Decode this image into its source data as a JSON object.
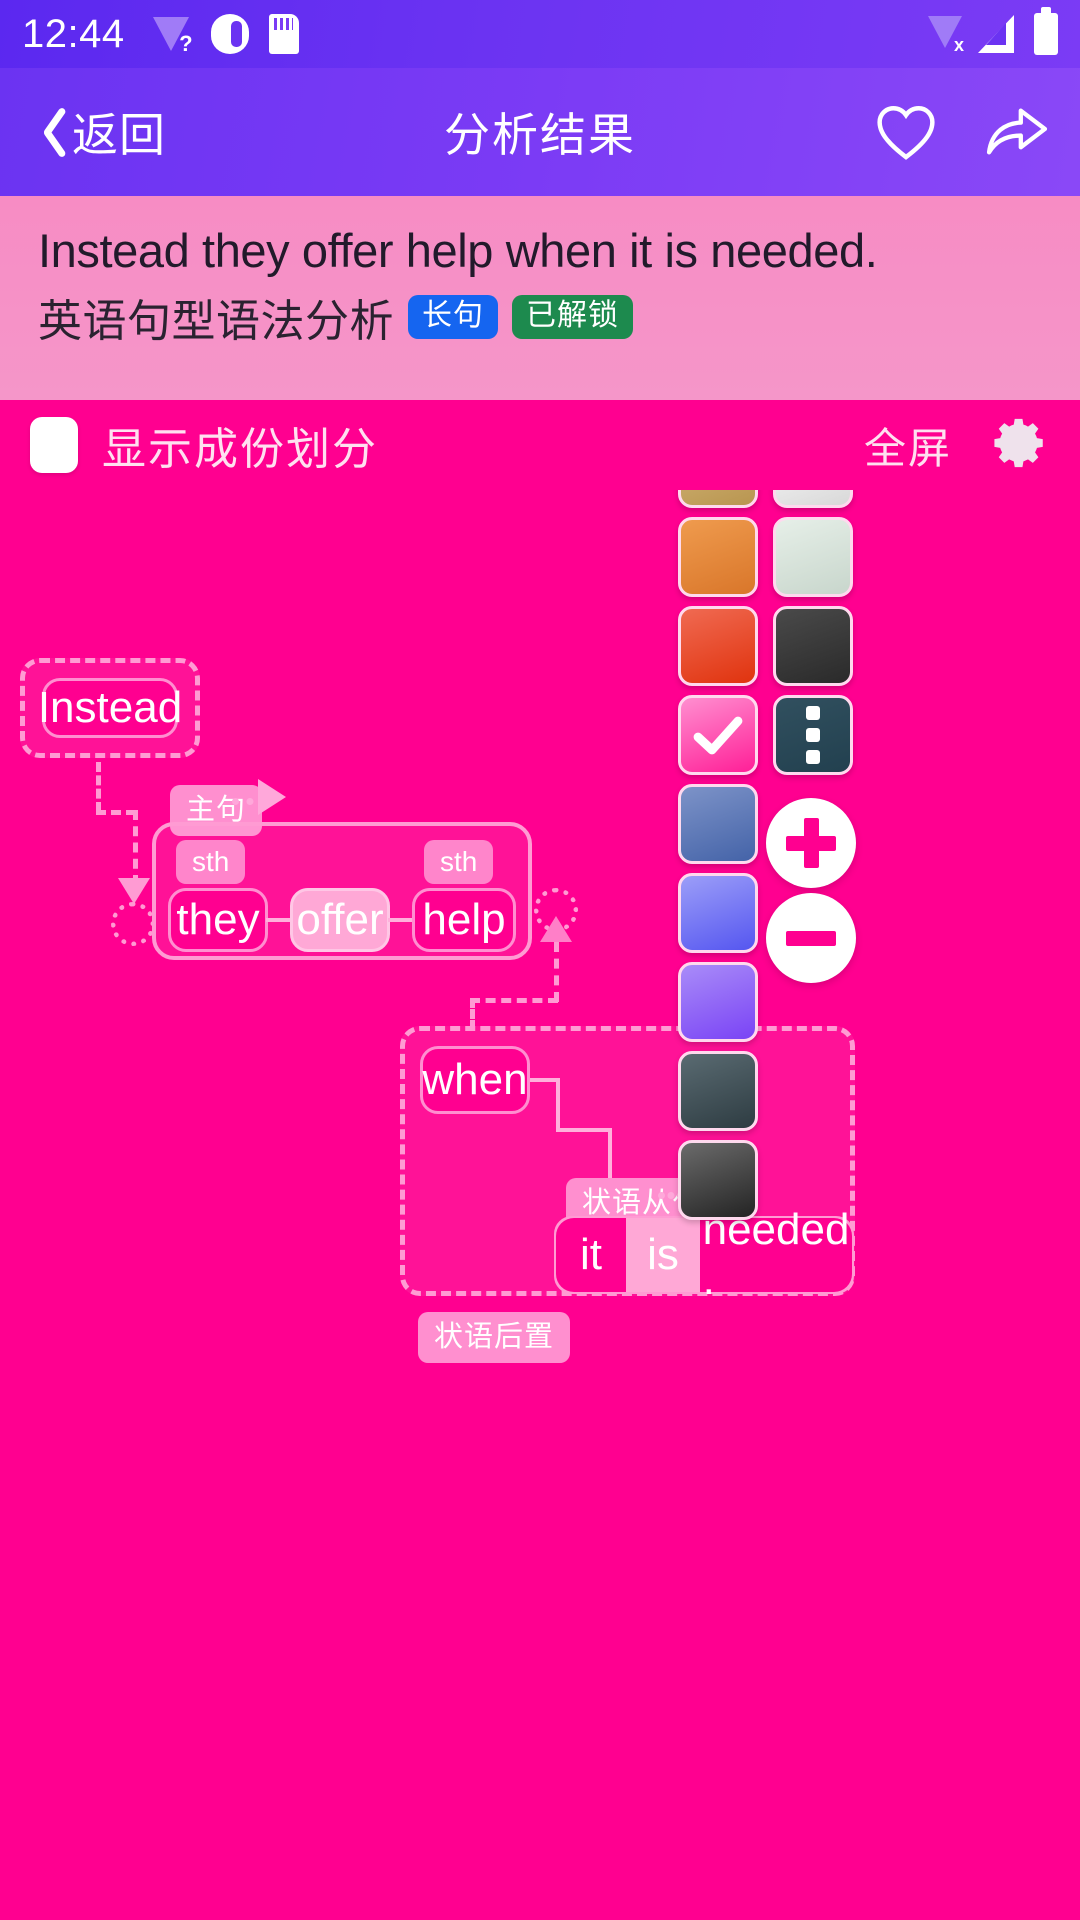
{
  "status_bar": {
    "time": "12:44",
    "left_icons": [
      "wifi-question-icon",
      "volume-icon",
      "sd-card-icon"
    ],
    "right_icons": [
      "wifi-off-icon",
      "signal-icon",
      "battery-icon"
    ]
  },
  "app_bar": {
    "back_label": "返回",
    "back_icon": "chevron-left-icon",
    "title": "分析结果",
    "favorite_icon": "heart-icon",
    "share_icon": "share-icon"
  },
  "sentence_panel": {
    "sentence": "Instead they offer help when it is needed.",
    "subtitle": "英语句型语法分析",
    "badges": [
      {
        "label": "长句",
        "color": "#1565F0"
      },
      {
        "label": "已解锁",
        "color": "#1D8A4E"
      }
    ]
  },
  "toolbar": {
    "checkbox_label": "显示成份划分",
    "checkbox_checked": false,
    "fullscreen_label": "全屏",
    "settings_icon": "gear-icon"
  },
  "diagram": {
    "adverbial_box": {
      "word": "Instead"
    },
    "main_clause_tag": "主句",
    "main_clause": {
      "subject": {
        "word": "they",
        "tag": "sth"
      },
      "verb": {
        "word": "offer"
      },
      "object": {
        "word": "help",
        "tag": "sth"
      }
    },
    "subordinate": {
      "conjunction": "when",
      "clause_tag": "状语从句",
      "subject": "it",
      "verb": "is",
      "complement": "needed .",
      "position_tag": "状语后置"
    }
  },
  "palette": {
    "swatches": [
      {
        "name": "tan",
        "from": "#D8BC7E",
        "to": "#B89550"
      },
      {
        "name": "white",
        "from": "#FFFFFF",
        "to": "#D8D8D8"
      },
      {
        "name": "orange",
        "from": "#EF9B4E",
        "to": "#D9762A"
      },
      {
        "name": "mint-grey",
        "from": "#E6EFE8",
        "to": "#C8D6CC"
      },
      {
        "name": "red",
        "from": "#F06A52",
        "to": "#E0330E"
      },
      {
        "name": "dark-grey",
        "from": "#4A4A4A",
        "to": "#2A2A2A"
      },
      {
        "name": "pink-selected",
        "from": "#FF8FD0",
        "to": "#FF1F97",
        "icon": "check-icon"
      },
      {
        "name": "slate-menu",
        "from": "#31505F",
        "to": "#22404F",
        "icon": "more-vertical-icon"
      },
      {
        "name": "steel-blue",
        "from": "#7D93C8",
        "to": "#4463A8"
      },
      {
        "name": "periwinkle",
        "from": "#9C9EF8",
        "to": "#5556F0"
      },
      {
        "name": "violet",
        "from": "#A98CF8",
        "to": "#7A43F5"
      },
      {
        "name": "slate-dark",
        "from": "#5A6B72",
        "to": "#2E3C42"
      },
      {
        "name": "charcoal",
        "from": "#6B6B6B",
        "to": "#242424"
      }
    ],
    "zoom_in_icon": "plus-circle-icon",
    "zoom_out_icon": "minus-circle-icon"
  }
}
